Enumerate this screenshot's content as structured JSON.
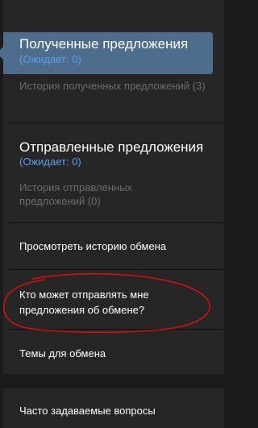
{
  "received": {
    "title": "Полученные предложения",
    "status": "(Ожидает: 0)",
    "history": "История полученных предложений (3)"
  },
  "sent": {
    "title": "Отправленные предложения",
    "status": "(Ожидает: 0)",
    "history": "История отправленных предложений (0)"
  },
  "links": {
    "trade_history": "Просмотреть историю обмена",
    "who_can_send": "Кто может отправлять мне предложения об обмене?",
    "trade_topics": "Темы для обмена"
  },
  "faq": {
    "label": "Часто задаваемые вопросы"
  },
  "colors": {
    "accent_blue": "#5b9ee8",
    "active_bg": "#4e6d8c",
    "annotation_red": "#d40f0f"
  }
}
